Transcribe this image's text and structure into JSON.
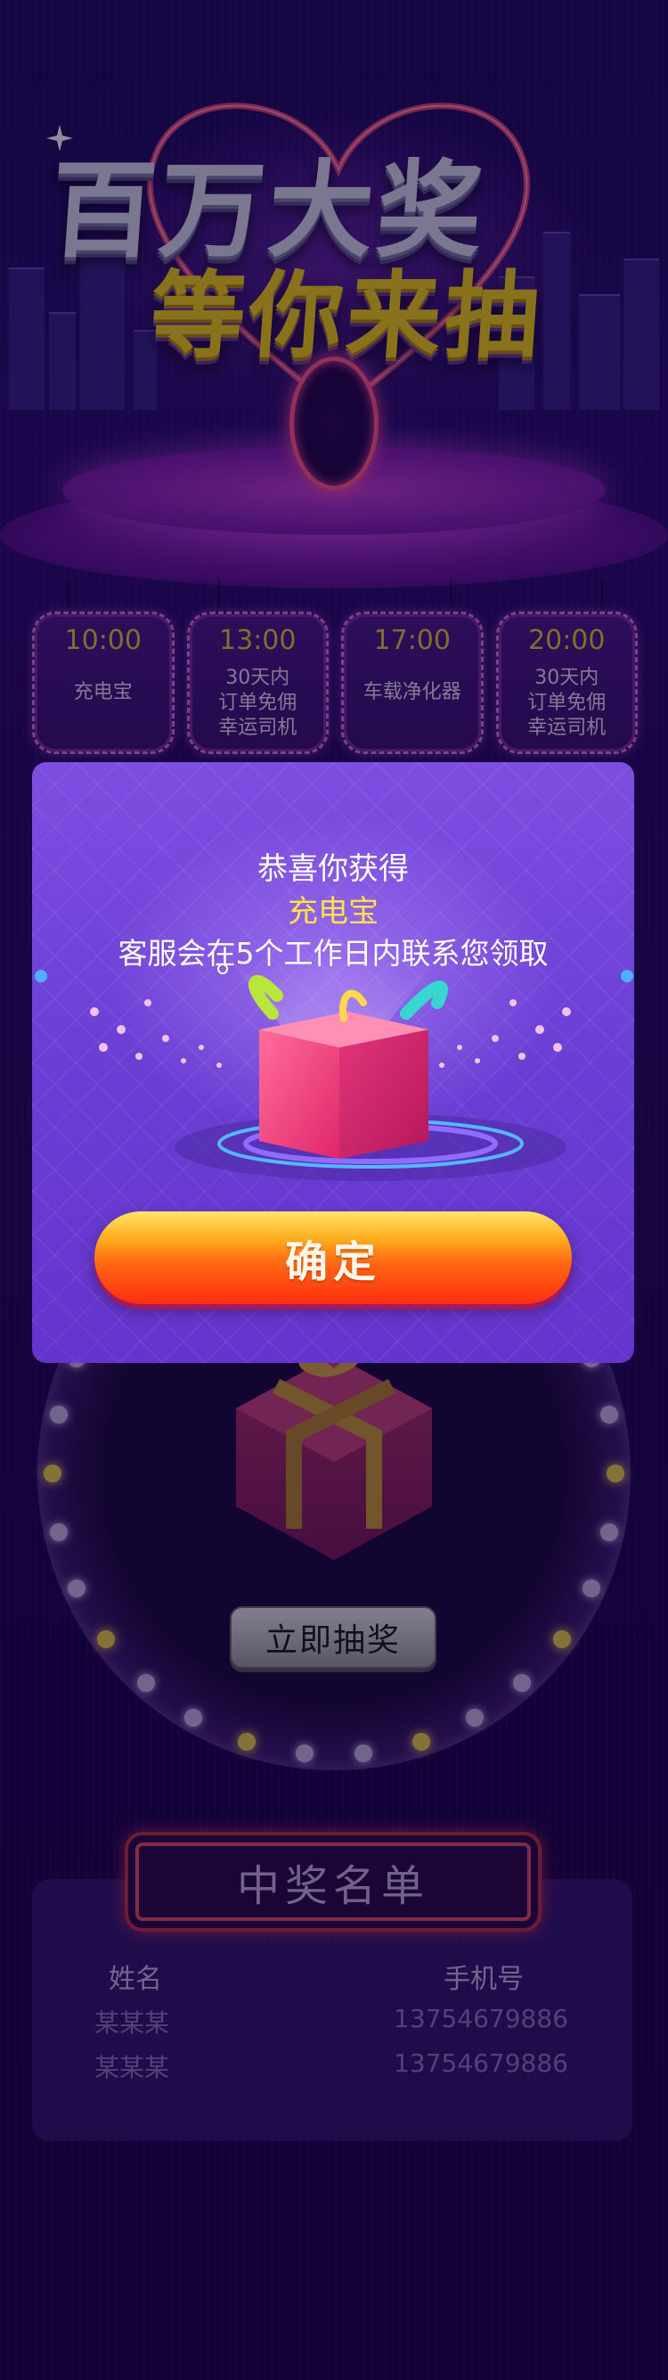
{
  "hero": {
    "title_line1": "百万大奖",
    "title_line2": "等你来抽"
  },
  "schedule": [
    {
      "time": "10:00",
      "prize": "充电宝"
    },
    {
      "time": "13:00",
      "prize": "30天内\n订单免佣\n幸运司机"
    },
    {
      "time": "17:00",
      "prize": "车载净化器"
    },
    {
      "time": "20:00",
      "prize": "30天内\n订单免佣\n幸运司机"
    }
  ],
  "wheel": {
    "draw_button": "立即抽奖"
  },
  "winners": {
    "title": "中奖名单",
    "columns": [
      "姓名",
      "手机号"
    ],
    "rows": [
      {
        "name": "某某某",
        "phone": "13754679886"
      },
      {
        "name": "某某某",
        "phone": "13754679886"
      }
    ]
  },
  "modal": {
    "title": "恭喜你获得",
    "prize": "充电宝",
    "note": "客服会在5个工作日内联系您领取",
    "confirm_label": "确定"
  },
  "colors": {
    "accent_gold": "#f2d01a",
    "prize_yellow": "#ffe14a",
    "modal_purple": "#6a3fd4",
    "button_orange": "#ff6a14"
  }
}
